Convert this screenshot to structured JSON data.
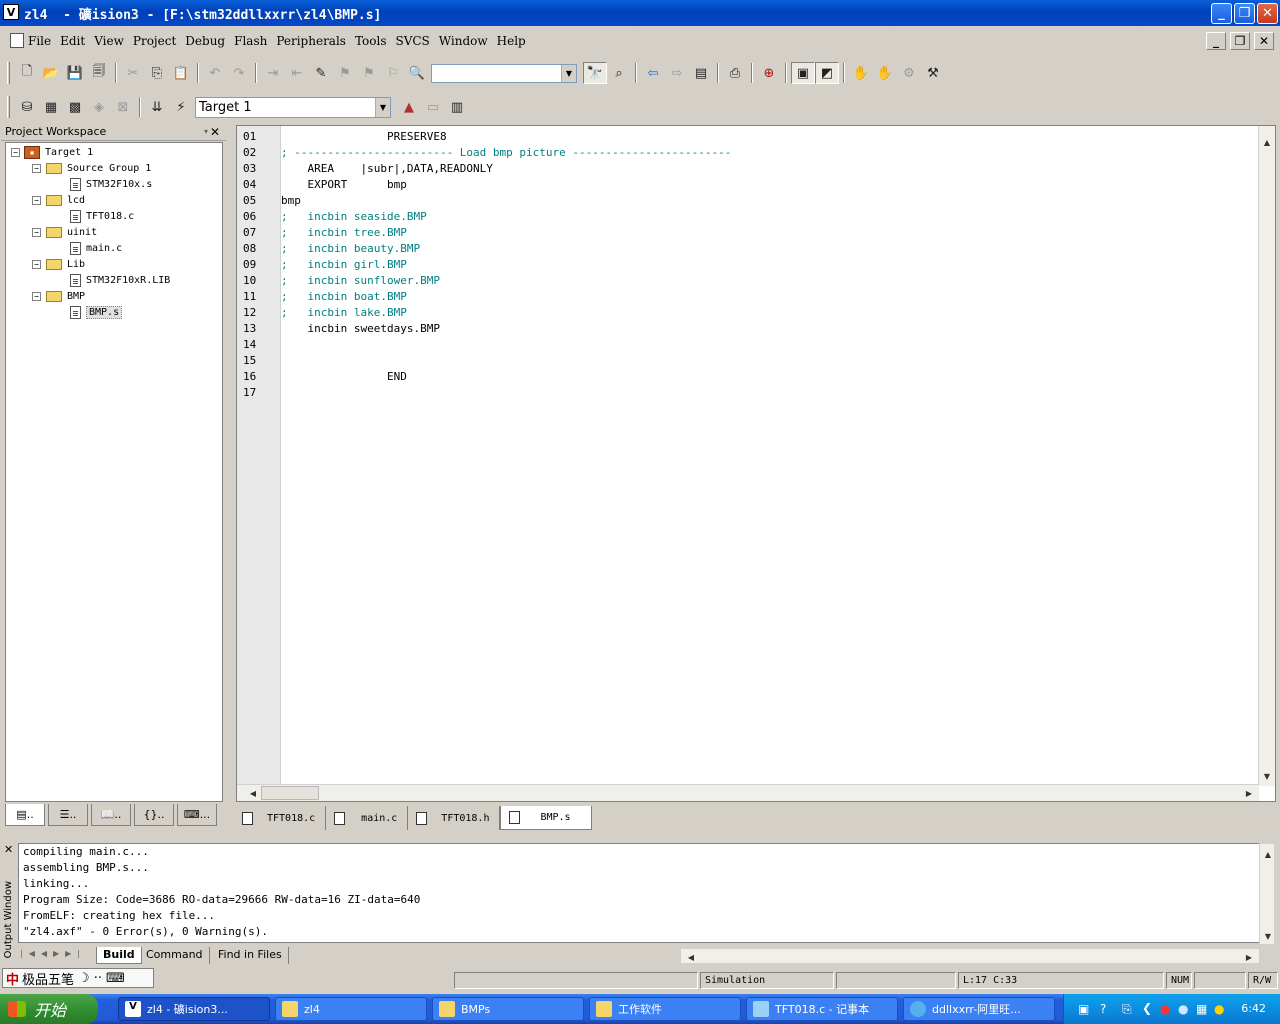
{
  "window": {
    "title": "zl4  - 礦ision3 - [F:\\stm32ddllxxrr\\zl4\\BMP.s]",
    "app_icon": "uvision-icon",
    "controls": [
      "minimize",
      "restore",
      "close"
    ]
  },
  "menu": [
    "File",
    "Edit",
    "View",
    "Project",
    "Debug",
    "Flash",
    "Peripherals",
    "Tools",
    "SVCS",
    "Window",
    "Help"
  ],
  "toolbar": {
    "find_value": "",
    "target": "Target 1"
  },
  "workspace": {
    "title": "Project Workspace",
    "tree": [
      {
        "label": "Target 1",
        "level": 0,
        "kind": "target"
      },
      {
        "label": "Source Group 1",
        "level": 1,
        "kind": "folder"
      },
      {
        "label": "STM32F10x.s",
        "level": 2,
        "kind": "file"
      },
      {
        "label": "lcd",
        "level": 1,
        "kind": "folder"
      },
      {
        "label": "TFT018.c",
        "level": 2,
        "kind": "file"
      },
      {
        "label": "uinit",
        "level": 1,
        "kind": "folder"
      },
      {
        "label": "main.c",
        "level": 2,
        "kind": "file"
      },
      {
        "label": "Lib",
        "level": 1,
        "kind": "folder"
      },
      {
        "label": "STM32F10xR.LIB",
        "level": 2,
        "kind": "file"
      },
      {
        "label": "BMP",
        "level": 1,
        "kind": "folder"
      },
      {
        "label": "BMP.s",
        "level": 2,
        "kind": "file",
        "selected": true
      }
    ],
    "tabs": [
      "..",
      "..",
      "..",
      "..",
      "..."
    ]
  },
  "editor": {
    "lines": [
      {
        "n": "01",
        "text": "                PRESERVE8",
        "comment": false
      },
      {
        "n": "02",
        "text": "; ------------------------ Load bmp picture ------------------------",
        "comment": true
      },
      {
        "n": "03",
        "text": "    AREA    |subr|,DATA,READONLY",
        "comment": false
      },
      {
        "n": "04",
        "text": "    EXPORT      bmp",
        "comment": false
      },
      {
        "n": "05",
        "text": "bmp",
        "comment": false
      },
      {
        "n": "06",
        "text": ";   incbin seaside.BMP",
        "comment": true
      },
      {
        "n": "07",
        "text": ";   incbin tree.BMP",
        "comment": true
      },
      {
        "n": "08",
        "text": ";   incbin beauty.BMP",
        "comment": true
      },
      {
        "n": "09",
        "text": ";   incbin girl.BMP",
        "comment": true
      },
      {
        "n": "10",
        "text": ";   incbin sunflower.BMP",
        "comment": true
      },
      {
        "n": "11",
        "text": ";   incbin boat.BMP",
        "comment": true
      },
      {
        "n": "12",
        "text": ";   incbin lake.BMP",
        "comment": true
      },
      {
        "n": "13",
        "text": "    incbin sweetdays.BMP",
        "comment": false
      },
      {
        "n": "14",
        "text": "",
        "comment": false
      },
      {
        "n": "15",
        "text": "",
        "comment": false
      },
      {
        "n": "16",
        "text": "                END",
        "comment": false
      },
      {
        "n": "17",
        "text": "",
        "comment": false
      }
    ],
    "tabs": [
      "TFT018.c",
      "main.c",
      "TFT018.h",
      "BMP.s"
    ],
    "active_tab": "BMP.s"
  },
  "output": {
    "side_label": "Output Window",
    "lines": [
      "compiling main.c...",
      "assembling BMP.s...",
      "linking...",
      "Program Size: Code=3686 RO-data=29666 RW-data=16 ZI-data=640",
      "FromELF: creating hex file...",
      "\"zl4.axf\" - 0 Error(s), 0 Warning(s)."
    ],
    "tabs": [
      "Build",
      "Command",
      "Find in Files"
    ],
    "active_tab": "Build"
  },
  "status": {
    "ime": "极品五笔",
    "mode": "Simulation",
    "position": "L:17 C:33",
    "num": "NUM",
    "rw": "R/W"
  },
  "taskbar": {
    "start": "开始",
    "tasks": [
      {
        "label": "zl4  - 礦ision3...",
        "active": true,
        "icon": "uvision-icon"
      },
      {
        "label": "zl4",
        "active": false,
        "icon": "folder-icon"
      },
      {
        "label": "BMPs",
        "active": false,
        "icon": "folder-icon"
      },
      {
        "label": "工作软件",
        "active": false,
        "icon": "folder-icon"
      },
      {
        "label": "TFT018.c - 记事本",
        "active": false,
        "icon": "notepad-icon"
      },
      {
        "label": "ddllxxrr-阿里旺...",
        "active": false,
        "icon": "chat-icon"
      }
    ],
    "clock": "6:42"
  }
}
